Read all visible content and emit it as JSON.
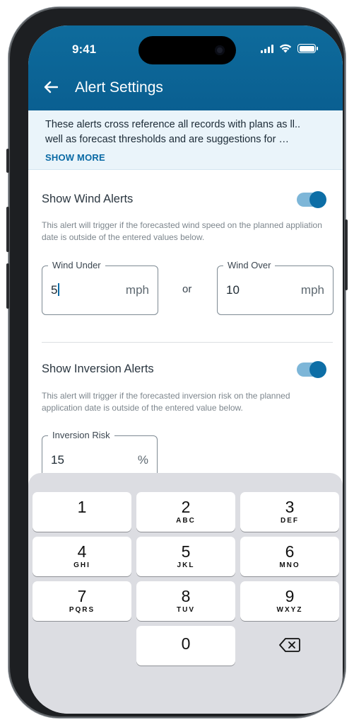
{
  "status_bar": {
    "time": "9:41"
  },
  "header": {
    "title": "Alert Settings"
  },
  "banner": {
    "line1": "These alerts cross reference all records with plans as ll..",
    "line2": "well as forecast thresholds and are suggestions for …",
    "show_more": "SHOW MORE"
  },
  "wind": {
    "title": "Show Wind Alerts",
    "enabled": true,
    "description": "This alert will trigger if the forecasted wind speed on the planned appliation date is outside of the entered values below.",
    "under": {
      "label": "Wind Under",
      "value": "5",
      "unit": "mph"
    },
    "or_label": "or",
    "over": {
      "label": "Wind Over",
      "value": "10",
      "unit": "mph"
    }
  },
  "inversion": {
    "title": "Show Inversion Alerts",
    "enabled": true,
    "description": "This alert will trigger if the forecasted inversion risk on the planned application date is outside of the entered value below.",
    "risk": {
      "label": "Inversion Risk",
      "value": "15",
      "unit": "%"
    }
  },
  "keyboard": {
    "keys": [
      {
        "num": "1",
        "letters": ""
      },
      {
        "num": "2",
        "letters": "ABC"
      },
      {
        "num": "3",
        "letters": "DEF"
      },
      {
        "num": "4",
        "letters": "GHI"
      },
      {
        "num": "5",
        "letters": "JKL"
      },
      {
        "num": "6",
        "letters": "MNO"
      },
      {
        "num": "7",
        "letters": "PQRS"
      },
      {
        "num": "8",
        "letters": "TUV"
      },
      {
        "num": "9",
        "letters": "WXYZ"
      },
      {
        "num": "0",
        "letters": ""
      }
    ]
  },
  "colors": {
    "header": "#0a5f91",
    "accent": "#0d6ea6",
    "banner_bg": "#eaf4fa",
    "keyboard_bg": "#dcdde2"
  }
}
